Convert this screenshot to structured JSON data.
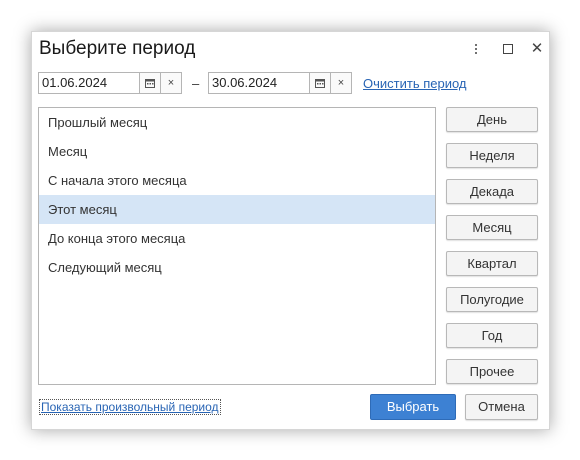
{
  "dialog": {
    "title": "Выберите период",
    "more_icon": "vertical-dots-icon",
    "maximize_icon": "maximize-icon",
    "close_icon": "close-icon"
  },
  "period": {
    "start_date": "01.06.2024",
    "end_date": "30.06.2024",
    "separator": "–",
    "clear_label": "×",
    "calendar_icon": "calendar-icon",
    "clear_period_link": "Очистить период"
  },
  "presets": [
    {
      "label": "Прошлый месяц"
    },
    {
      "label": "Месяц"
    },
    {
      "label": "С начала этого месяца"
    },
    {
      "label": "Этот месяц"
    },
    {
      "label": "До конца этого месяца"
    },
    {
      "label": "Следующий месяц"
    }
  ],
  "selected_preset": "Этот месяц",
  "period_types": [
    "День",
    "Неделя",
    "Декада",
    "Месяц",
    "Квартал",
    "Полугодие",
    "Год",
    "Прочее"
  ],
  "footer": {
    "show_custom_link": "Показать произвольный период",
    "ok_label": "Выбрать",
    "cancel_label": "Отмена"
  },
  "colors": {
    "accent": "#3d81d3",
    "selection": "#d5e5f6",
    "link": "#2864b4"
  }
}
